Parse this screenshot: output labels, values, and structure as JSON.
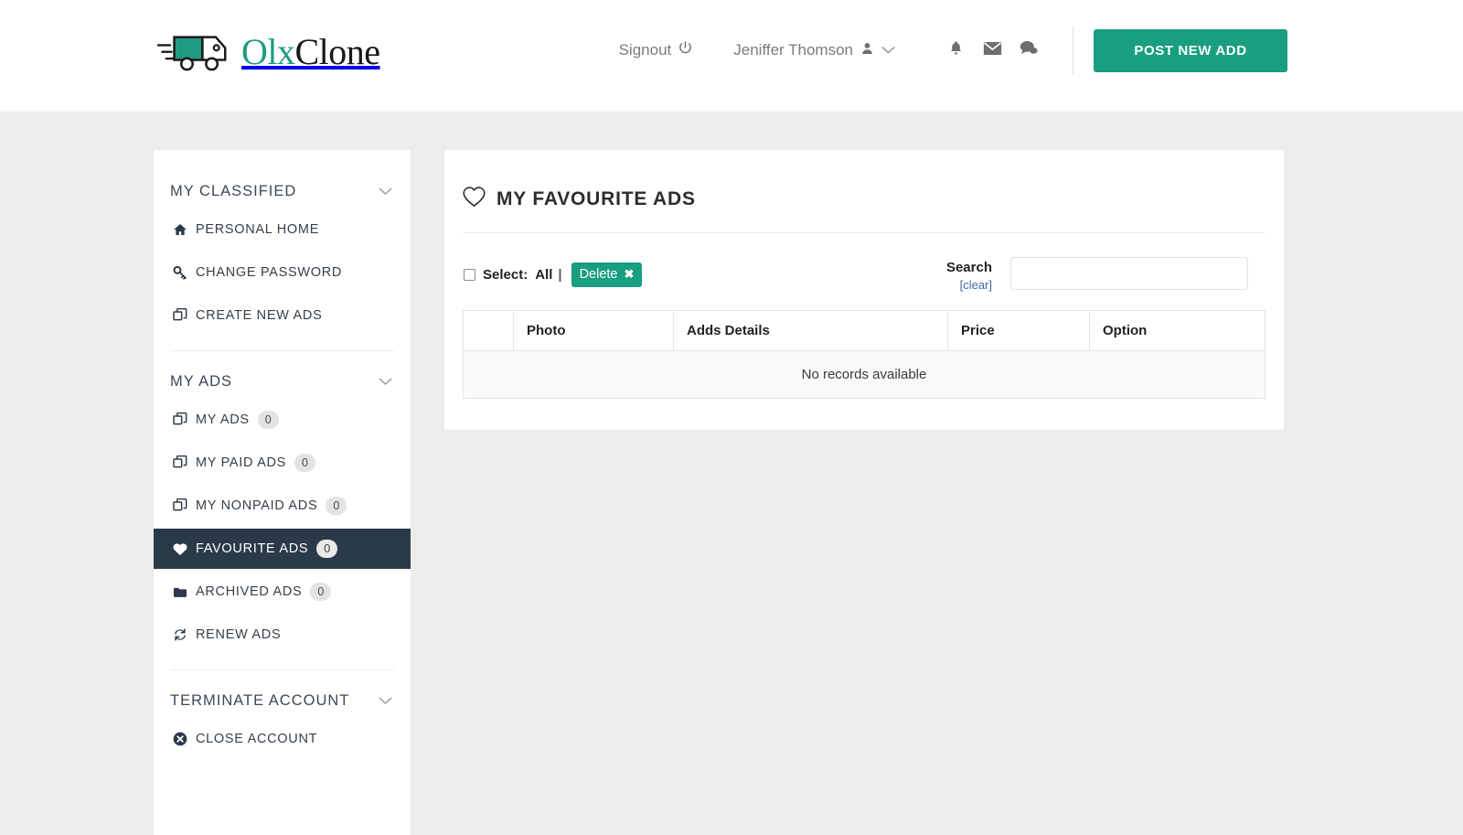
{
  "brand": {
    "name_part1": "Olx",
    "name_part2": "Clone",
    "accent_color": "#1a9e80",
    "dark_color": "#2b3a4a"
  },
  "header": {
    "signout_label": "Signout",
    "user_name": "Jeniffer Thomson",
    "post_button_label": "POST NEW ADD",
    "icons": {
      "power": "power-icon",
      "user": "user-icon",
      "chevron": "chevron-down-icon",
      "bell": "bell-icon",
      "envelope": "envelope-icon",
      "chat": "chat-icon"
    }
  },
  "sidebar": {
    "sections": [
      {
        "title": "MY CLASSIFIED",
        "items": [
          {
            "label": "PERSONAL HOME",
            "icon": "home-icon",
            "badge": null,
            "active": false
          },
          {
            "label": "CHANGE PASSWORD",
            "icon": "key-icon",
            "badge": null,
            "active": false
          },
          {
            "label": "CREATE NEW ADS",
            "icon": "clone-icon",
            "badge": null,
            "active": false
          }
        ]
      },
      {
        "title": "MY ADS",
        "items": [
          {
            "label": "MY ADS",
            "icon": "clone-icon",
            "badge": "0",
            "active": false
          },
          {
            "label": "MY PAID ADS",
            "icon": "clone-icon",
            "badge": "0",
            "active": false
          },
          {
            "label": "MY NONPAID ADS",
            "icon": "clone-icon",
            "badge": "0",
            "active": false
          },
          {
            "label": "FAVOURITE ADS",
            "icon": "heart-filled-icon",
            "badge": "0",
            "active": true
          },
          {
            "label": "ARCHIVED ADS",
            "icon": "archive-icon",
            "badge": "0",
            "active": false
          },
          {
            "label": "RENEW ADS",
            "icon": "refresh-icon",
            "badge": null,
            "active": false
          }
        ]
      },
      {
        "title": "TERMINATE ACCOUNT",
        "items": [
          {
            "label": "CLOSE ACCOUNT",
            "icon": "close-circle-icon",
            "badge": null,
            "active": false
          }
        ]
      }
    ]
  },
  "main": {
    "title": "MY FAVOURITE ADS",
    "title_icon": "heart-outline-icon",
    "toolbar": {
      "select_prefix": "Select:",
      "select_all_label": "All",
      "separator": "|",
      "delete_label": "Delete",
      "delete_icon": "close-x-icon",
      "checkbox_checked": false
    },
    "search": {
      "label": "Search",
      "clear_label": "[clear]",
      "value": "",
      "placeholder": ""
    },
    "table": {
      "columns": [
        "",
        "Photo",
        "Adds Details",
        "Price",
        "Option"
      ],
      "rows": [],
      "empty_message": "No records available"
    }
  }
}
